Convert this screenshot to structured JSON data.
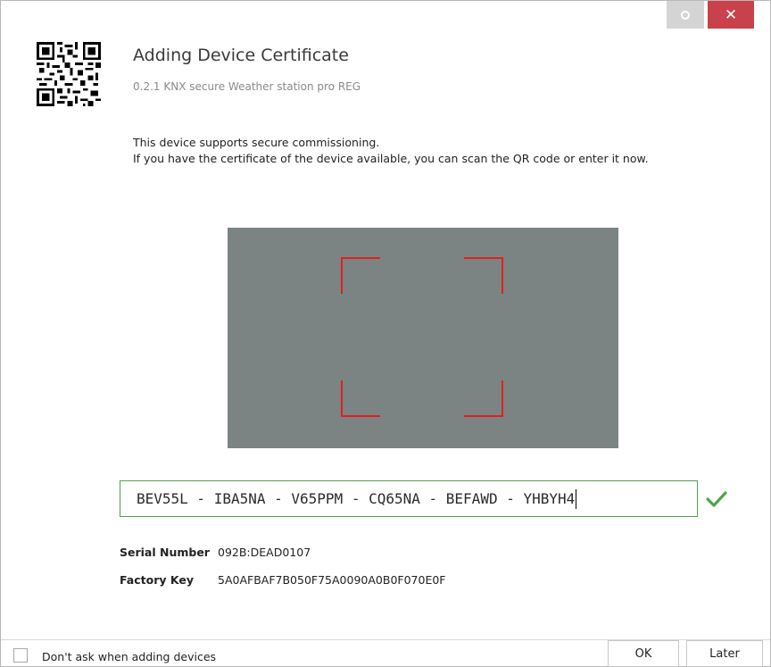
{
  "window": {
    "title": "Adding Device Certificate",
    "subtitle": "0.2.1 KNX secure Weather station pro REG",
    "close_glyph": "✕"
  },
  "description": {
    "line1": "This device supports secure commissioning.",
    "line2": "If you have the certificate of the device available, you can scan the QR code or enter it now."
  },
  "scanner": {
    "background": "#7b8483",
    "frame_color": "#e02020"
  },
  "certificate": {
    "value": "BEV55L - IBA5NA - V65PPM - CQ65NA - BEFAWD - YHBYH4",
    "valid_icon": "check-icon",
    "valid_color": "#4fa34a"
  },
  "info": {
    "serial_label": "Serial Number",
    "serial_value": "092B:DEAD0107",
    "factory_label": "Factory Key",
    "factory_value": "5A0AFBAF7B050F75A0090A0B0F070E0F"
  },
  "footer": {
    "checkbox_label": "Don't ask when adding devices",
    "ok_label": "OK",
    "later_label": "Later"
  },
  "icons": {
    "qr": "qr-code-icon",
    "settings": "settings-dot-icon",
    "close": "close-icon"
  },
  "colors": {
    "close_button": "#c8414b",
    "accent_green": "#4fa34a"
  }
}
